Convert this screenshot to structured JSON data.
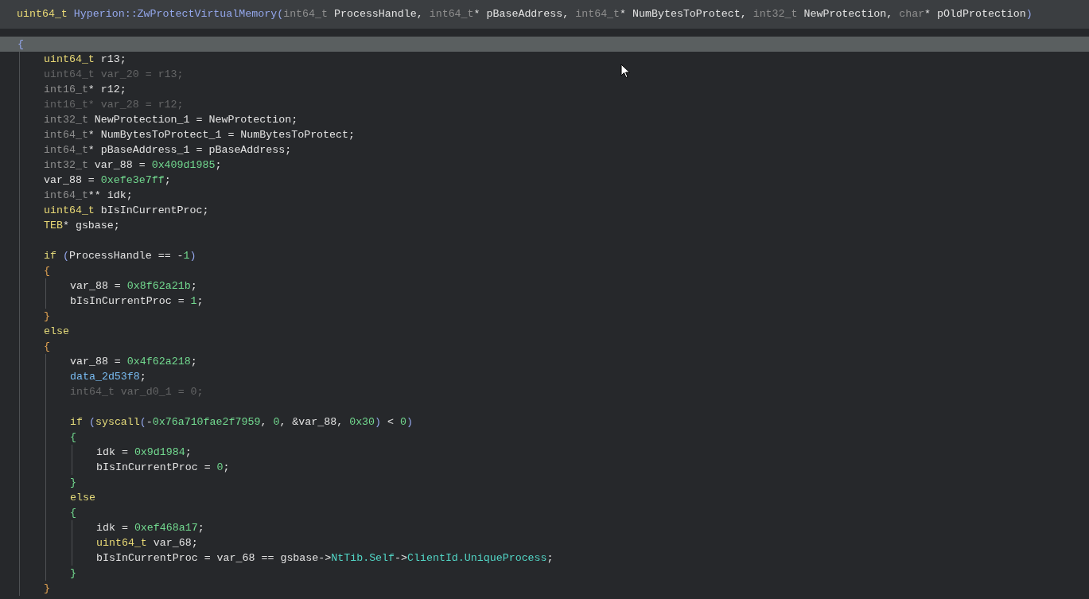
{
  "signature": [
    {
      "kind": "ut",
      "text": "uint64_t"
    },
    {
      "kind": "f",
      "text": " Hyperion::ZwProtectVirtualMemory("
    },
    {
      "kind": "ty",
      "text": "int64_t"
    },
    {
      "kind": "v",
      "text": " ProcessHandle, "
    },
    {
      "kind": "ty",
      "text": "int64_t"
    },
    {
      "kind": "v",
      "text": "* pBaseAddress, "
    },
    {
      "kind": "ty",
      "text": "int64_t"
    },
    {
      "kind": "v",
      "text": "* NumBytesToProtect, "
    },
    {
      "kind": "ty",
      "text": "int32_t"
    },
    {
      "kind": "v",
      "text": " NewProtection, "
    },
    {
      "kind": "ty",
      "text": "char"
    },
    {
      "kind": "v",
      "text": "* pOldProtection"
    },
    {
      "kind": "f",
      "text": ")"
    }
  ],
  "body": {
    "kind": "block",
    "open": [
      {
        "kind": "b0",
        "text": "{"
      }
    ],
    "open_highlighted": true,
    "children": [
      {
        "kind": "line",
        "dim": false,
        "tokens": [
          {
            "kind": "ut",
            "text": "uint64_t"
          },
          {
            "kind": "v",
            "text": " r13;"
          }
        ]
      },
      {
        "kind": "line",
        "dim": true,
        "tokens": [
          {
            "kind": "ty",
            "text": "uint64_t var_20 = r13;"
          }
        ]
      },
      {
        "kind": "line",
        "dim": false,
        "tokens": [
          {
            "kind": "ty",
            "text": "int16_t"
          },
          {
            "kind": "v",
            "text": "* r12;"
          }
        ]
      },
      {
        "kind": "line",
        "dim": true,
        "tokens": [
          {
            "kind": "ty",
            "text": "int16_t* var_28 = r12;"
          }
        ]
      },
      {
        "kind": "line",
        "dim": false,
        "tokens": [
          {
            "kind": "ty",
            "text": "int32_t"
          },
          {
            "kind": "v",
            "text": " NewProtection_1 = NewProtection;"
          }
        ]
      },
      {
        "kind": "line",
        "dim": false,
        "tokens": [
          {
            "kind": "ty",
            "text": "int64_t"
          },
          {
            "kind": "v",
            "text": "* NumBytesToProtect_1 = NumBytesToProtect;"
          }
        ]
      },
      {
        "kind": "line",
        "dim": false,
        "tokens": [
          {
            "kind": "ty",
            "text": "int64_t"
          },
          {
            "kind": "v",
            "text": "* pBaseAddress_1 = pBaseAddress;"
          }
        ]
      },
      {
        "kind": "line",
        "dim": false,
        "tokens": [
          {
            "kind": "ty",
            "text": "int32_t"
          },
          {
            "kind": "v",
            "text": " var_88 = "
          },
          {
            "kind": "n",
            "text": "0x409d1985"
          },
          {
            "kind": "v",
            "text": ";"
          }
        ]
      },
      {
        "kind": "line",
        "dim": false,
        "tokens": [
          {
            "kind": "v",
            "text": "var_88 = "
          },
          {
            "kind": "n",
            "text": "0xefe3e7ff"
          },
          {
            "kind": "v",
            "text": ";"
          }
        ]
      },
      {
        "kind": "line",
        "dim": false,
        "tokens": [
          {
            "kind": "ty",
            "text": "int64_t"
          },
          {
            "kind": "v",
            "text": "** idk;"
          }
        ]
      },
      {
        "kind": "line",
        "dim": false,
        "tokens": [
          {
            "kind": "ut",
            "text": "uint64_t"
          },
          {
            "kind": "v",
            "text": " bIsInCurrentProc;"
          }
        ]
      },
      {
        "kind": "line",
        "dim": false,
        "tokens": [
          {
            "kind": "ut",
            "text": "TEB"
          },
          {
            "kind": "v",
            "text": "* gsbase;"
          }
        ]
      },
      {
        "kind": "blank"
      },
      {
        "kind": "line",
        "dim": false,
        "tokens": [
          {
            "kind": "kw",
            "text": "if"
          },
          {
            "kind": "pr",
            "text": " ("
          },
          {
            "kind": "v",
            "text": "ProcessHandle == -"
          },
          {
            "kind": "n",
            "text": "1"
          },
          {
            "kind": "pr",
            "text": ")"
          }
        ]
      },
      {
        "kind": "block",
        "open": [
          {
            "kind": "b1",
            "text": "{"
          }
        ],
        "close": [
          {
            "kind": "b1",
            "text": "}"
          }
        ],
        "open_highlighted": false,
        "children": [
          {
            "kind": "line",
            "dim": false,
            "tokens": [
              {
                "kind": "v",
                "text": "var_88 = "
              },
              {
                "kind": "n",
                "text": "0x8f62a21b"
              },
              {
                "kind": "v",
                "text": ";"
              }
            ]
          },
          {
            "kind": "line",
            "dim": false,
            "tokens": [
              {
                "kind": "v",
                "text": "bIsInCurrentProc = "
              },
              {
                "kind": "n",
                "text": "1"
              },
              {
                "kind": "v",
                "text": ";"
              }
            ]
          }
        ]
      },
      {
        "kind": "line",
        "dim": false,
        "tokens": [
          {
            "kind": "kw",
            "text": "else"
          }
        ]
      },
      {
        "kind": "block",
        "open": [
          {
            "kind": "b1",
            "text": "{"
          }
        ],
        "close": [
          {
            "kind": "b1",
            "text": "}"
          }
        ],
        "open_highlighted": false,
        "children": [
          {
            "kind": "line",
            "dim": false,
            "tokens": [
              {
                "kind": "v",
                "text": "var_88 = "
              },
              {
                "kind": "n",
                "text": "0x4f62a218"
              },
              {
                "kind": "v",
                "text": ";"
              }
            ]
          },
          {
            "kind": "line",
            "dim": false,
            "tokens": [
              {
                "kind": "d",
                "text": "data_2d53f8"
              },
              {
                "kind": "v",
                "text": ";"
              }
            ]
          },
          {
            "kind": "line",
            "dim": true,
            "tokens": [
              {
                "kind": "ty",
                "text": "int64_t var_d0_1 = 0;"
              }
            ]
          },
          {
            "kind": "blank"
          },
          {
            "kind": "line",
            "dim": false,
            "tokens": [
              {
                "kind": "kw",
                "text": "if"
              },
              {
                "kind": "pr",
                "text": " ("
              },
              {
                "kind": "kw",
                "text": "syscall"
              },
              {
                "kind": "pr",
                "text": "("
              },
              {
                "kind": "v",
                "text": "-"
              },
              {
                "kind": "n",
                "text": "0x76a710fae2f7959"
              },
              {
                "kind": "v",
                "text": ", "
              },
              {
                "kind": "n",
                "text": "0"
              },
              {
                "kind": "v",
                "text": ", &var_88, "
              },
              {
                "kind": "n",
                "text": "0x30"
              },
              {
                "kind": "pr",
                "text": ")"
              },
              {
                "kind": "v",
                "text": " < "
              },
              {
                "kind": "n",
                "text": "0"
              },
              {
                "kind": "pr",
                "text": ")"
              }
            ]
          },
          {
            "kind": "block",
            "open": [
              {
                "kind": "b2",
                "text": "{"
              }
            ],
            "close": [
              {
                "kind": "b2",
                "text": "}"
              }
            ],
            "open_highlighted": false,
            "children": [
              {
                "kind": "line",
                "dim": false,
                "tokens": [
                  {
                    "kind": "v",
                    "text": "idk = "
                  },
                  {
                    "kind": "n",
                    "text": "0x9d1984"
                  },
                  {
                    "kind": "v",
                    "text": ";"
                  }
                ]
              },
              {
                "kind": "line",
                "dim": false,
                "tokens": [
                  {
                    "kind": "v",
                    "text": "bIsInCurrentProc = "
                  },
                  {
                    "kind": "n",
                    "text": "0"
                  },
                  {
                    "kind": "v",
                    "text": ";"
                  }
                ]
              }
            ]
          },
          {
            "kind": "line",
            "dim": false,
            "tokens": [
              {
                "kind": "kw",
                "text": "else"
              }
            ]
          },
          {
            "kind": "block",
            "open": [
              {
                "kind": "b2",
                "text": "{"
              }
            ],
            "close": [
              {
                "kind": "b2",
                "text": "}"
              }
            ],
            "open_highlighted": false,
            "children": [
              {
                "kind": "line",
                "dim": false,
                "tokens": [
                  {
                    "kind": "v",
                    "text": "idk = "
                  },
                  {
                    "kind": "n",
                    "text": "0xef468a17"
                  },
                  {
                    "kind": "v",
                    "text": ";"
                  }
                ]
              },
              {
                "kind": "line",
                "dim": false,
                "tokens": [
                  {
                    "kind": "ut",
                    "text": "uint64_t"
                  },
                  {
                    "kind": "v",
                    "text": " var_68;"
                  }
                ]
              },
              {
                "kind": "line",
                "dim": false,
                "tokens": [
                  {
                    "kind": "v",
                    "text": "bIsInCurrentProc = var_68 == gsbase->"
                  },
                  {
                    "kind": "m",
                    "text": "NtTib.Self"
                  },
                  {
                    "kind": "v",
                    "text": "->"
                  },
                  {
                    "kind": "m",
                    "text": "ClientId.UniqueProcess"
                  },
                  {
                    "kind": "v",
                    "text": ";"
                  }
                ]
              }
            ]
          }
        ]
      }
    ]
  }
}
